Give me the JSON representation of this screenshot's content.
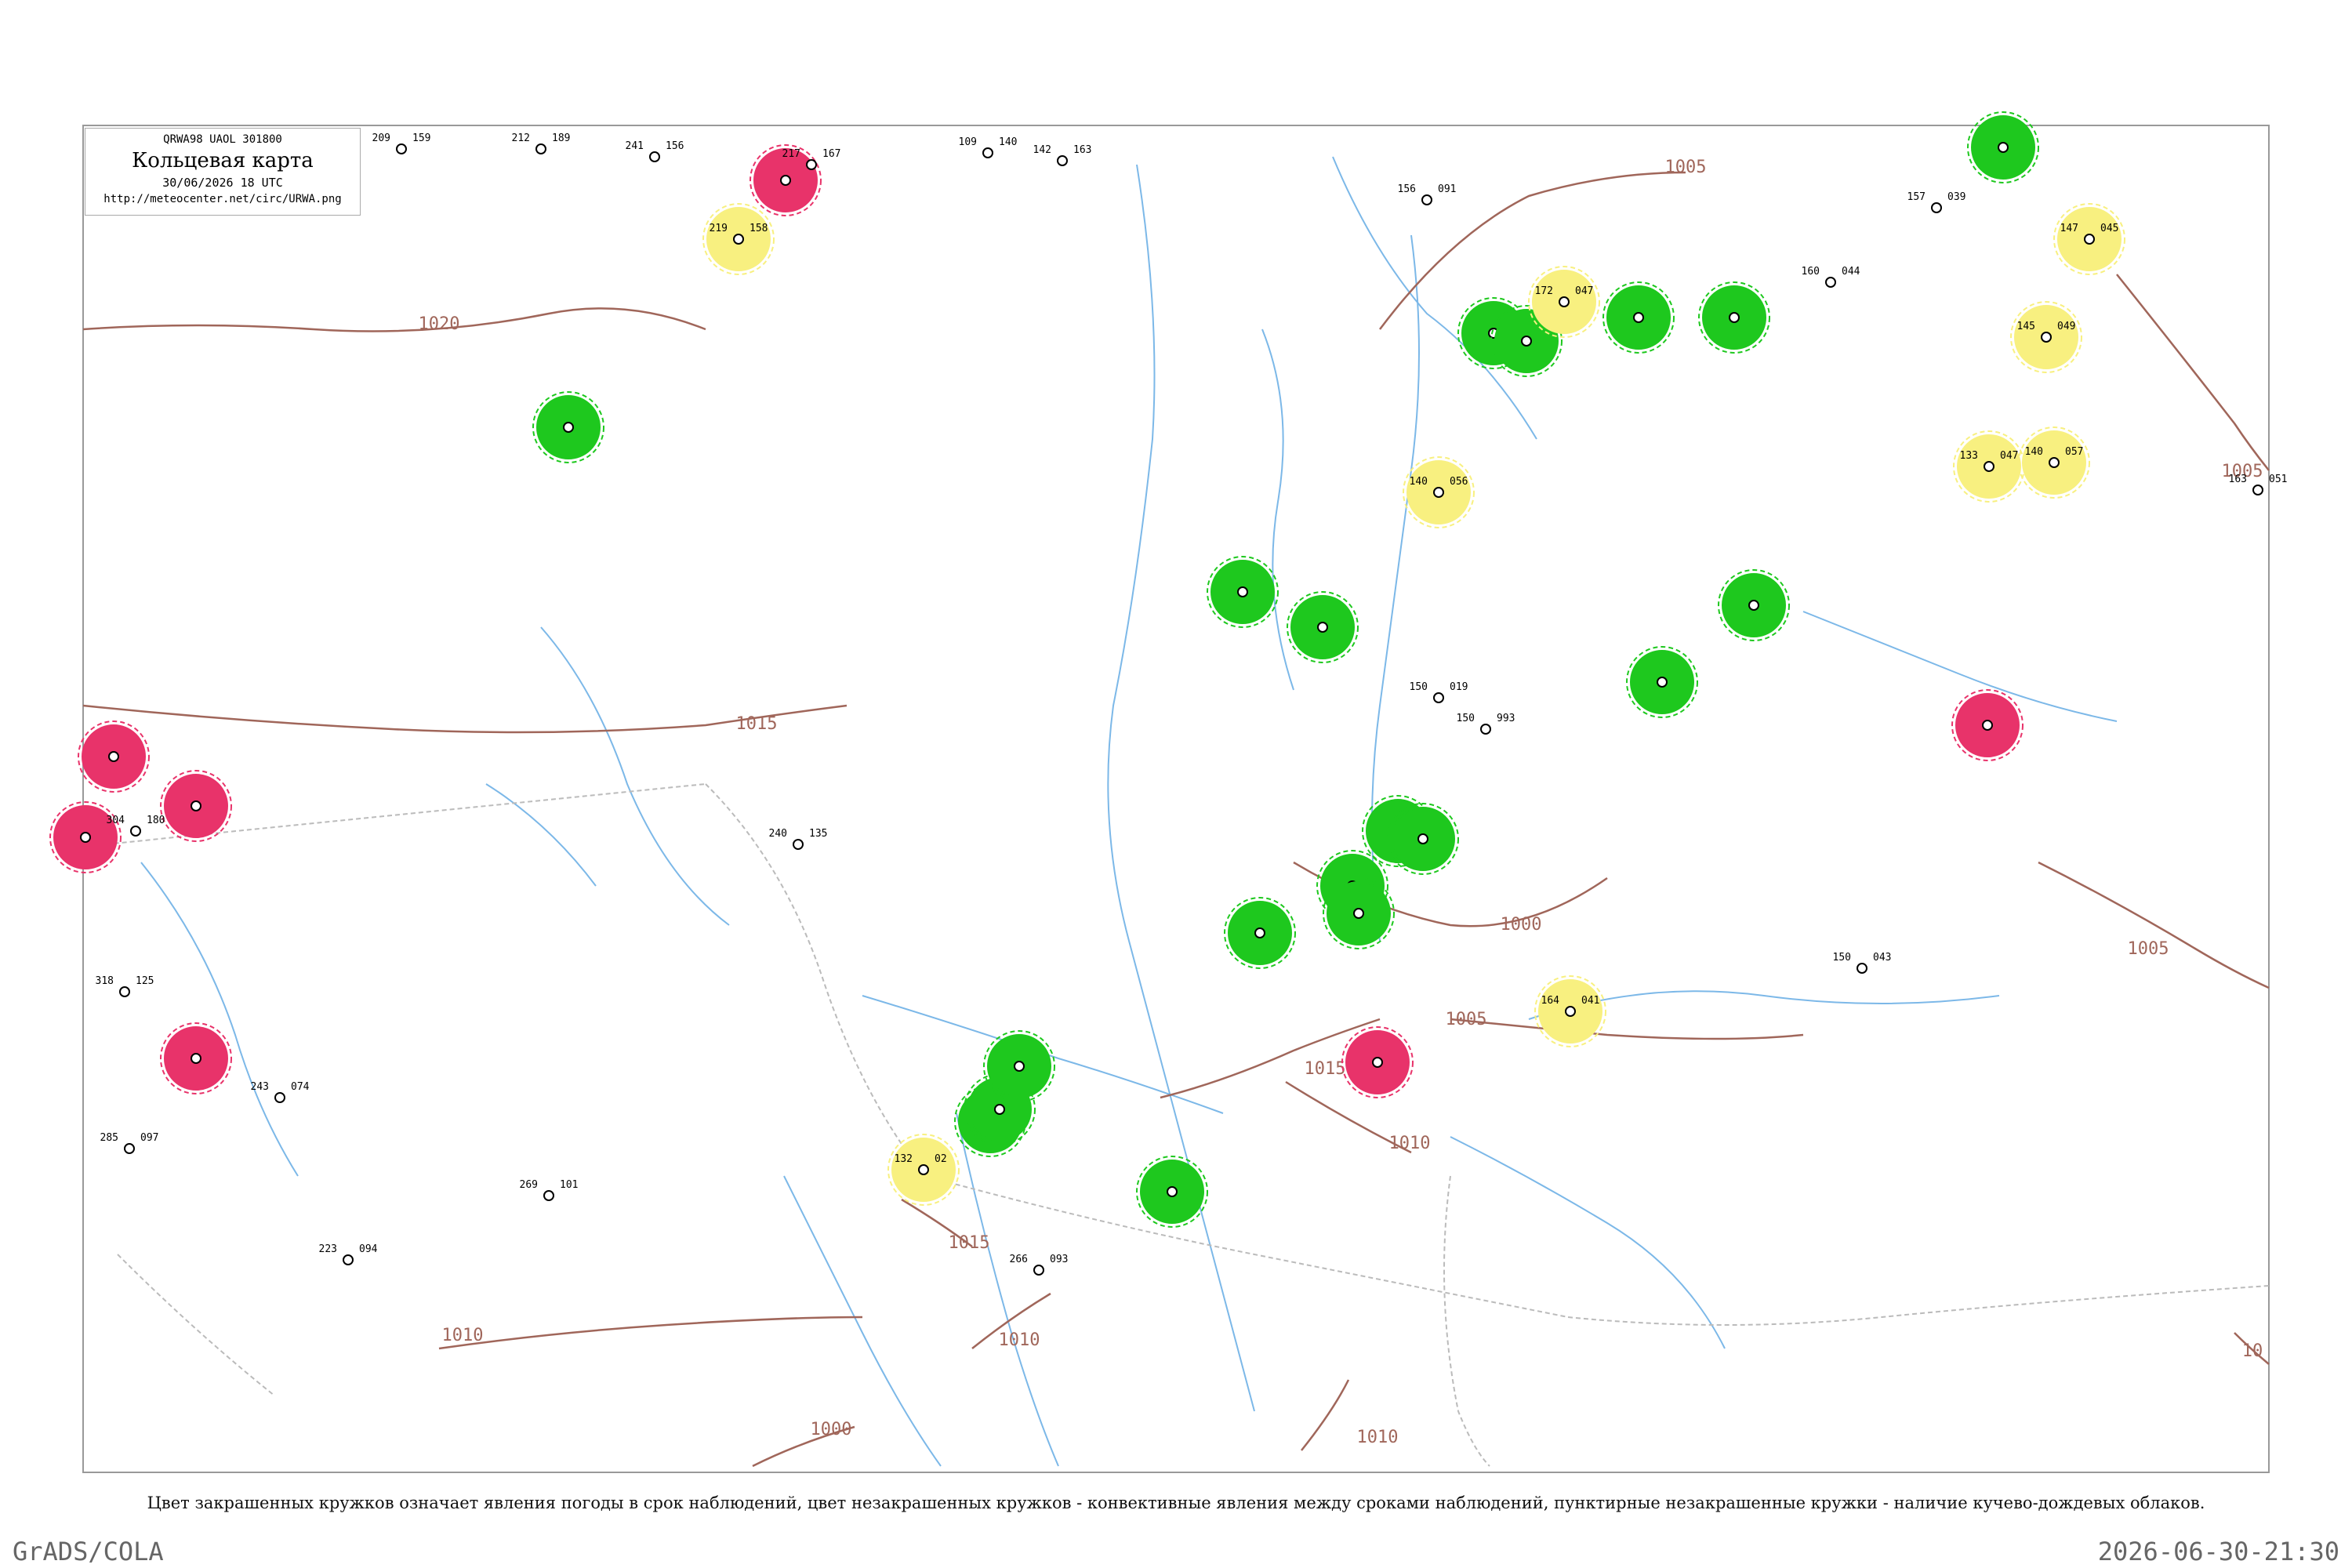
{
  "header": {
    "code_line": "QRWA98 UAOL 301800",
    "title": "Кольцевая карта",
    "datetime": "30/06/2026 18 UTC",
    "url": "http://meteocenter.net/circ/URWA.png"
  },
  "legend_text": "Цвет закрашенных кружков означает явления погоды в срок наблюдений, цвет незакрашенных кружков - конвективные явления между сроками наблюдений, пунктирные незакрашенные кружки - наличие кучево-дождевых облаков.",
  "footer": {
    "left": "GrADS/COLA",
    "right": "2026-06-30-21:30"
  },
  "colors": {
    "isobar": "#a0665a",
    "river": "#7cb8e8",
    "border": "#bbbbbb",
    "green": "#1ec81e",
    "red": "#e8336a",
    "yellow": "#f8f080"
  },
  "isobar_labels": [
    "1020",
    "1015",
    "1015",
    "1010",
    "1010",
    "1010",
    "1005",
    "1005",
    "1005",
    "1005",
    "1000",
    "1000",
    "1015",
    "1010",
    "10"
  ],
  "stations": [
    {
      "type": "green-filled",
      "p": "",
      "t": ""
    },
    {
      "type": "red-filled",
      "p": "",
      "t": ""
    },
    {
      "type": "yellow-filled",
      "p": "158",
      "t": "219"
    },
    {
      "type": "green-filled",
      "p": "",
      "t": ""
    },
    {
      "type": "green-filled",
      "p": "",
      "t": ""
    },
    {
      "type": "yellow-filled",
      "p": "047",
      "t": "172"
    },
    {
      "type": "green-filled",
      "p": "",
      "t": ""
    },
    {
      "type": "green-filled",
      "p": "",
      "t": ""
    },
    {
      "type": "yellow-filled",
      "p": "045",
      "t": "147"
    },
    {
      "type": "yellow-filled",
      "p": "049",
      "t": "145"
    },
    {
      "type": "yellow-filled",
      "p": "047",
      "t": "133"
    },
    {
      "type": "yellow-filled",
      "p": "057",
      "t": "140"
    },
    {
      "type": "yellow-filled",
      "p": "056",
      "t": "140"
    },
    {
      "type": "green-filled",
      "p": "",
      "t": ""
    },
    {
      "type": "green-filled",
      "p": "",
      "t": ""
    },
    {
      "type": "green-filled",
      "p": "",
      "t": ""
    },
    {
      "type": "green-filled",
      "p": "",
      "t": ""
    },
    {
      "type": "red-filled",
      "p": "",
      "t": ""
    },
    {
      "type": "green-filled",
      "p": "",
      "t": ""
    },
    {
      "type": "red-filled",
      "p": "",
      "t": ""
    },
    {
      "type": "red-filled",
      "p": "",
      "t": ""
    },
    {
      "type": "red-filled",
      "p": "",
      "t": ""
    },
    {
      "type": "green-filled",
      "p": "",
      "t": ""
    },
    {
      "type": "green-filled",
      "p": "",
      "t": ""
    },
    {
      "type": "green-filled",
      "p": "",
      "t": ""
    },
    {
      "type": "green-filled",
      "p": "",
      "t": ""
    },
    {
      "type": "green-filled",
      "p": "",
      "t": ""
    },
    {
      "type": "red-filled",
      "p": "",
      "t": ""
    },
    {
      "type": "yellow-filled",
      "p": "041",
      "t": "164"
    },
    {
      "type": "green-filled",
      "p": "",
      "t": ""
    },
    {
      "type": "red-filled",
      "p": "",
      "t": ""
    },
    {
      "type": "yellow-filled",
      "p": "02",
      "t": "132"
    },
    {
      "type": "green-filled",
      "p": "",
      "t": ""
    },
    {
      "type": "green-filled",
      "p": "",
      "t": ""
    },
    {
      "type": "green-filled",
      "p": "",
      "t": ""
    },
    {
      "type": "plain",
      "p": "159",
      "t": "209"
    },
    {
      "type": "plain",
      "p": "189",
      "t": "212"
    },
    {
      "type": "plain",
      "p": "156",
      "t": "241"
    },
    {
      "type": "plain",
      "p": "167",
      "t": "217"
    },
    {
      "type": "plain",
      "p": "140",
      "t": "109"
    },
    {
      "type": "plain",
      "p": "163",
      "t": "142"
    },
    {
      "type": "plain",
      "p": "091",
      "t": "156"
    },
    {
      "type": "plain",
      "p": "039",
      "t": "157"
    },
    {
      "type": "plain",
      "p": "044",
      "t": "160"
    },
    {
      "type": "plain",
      "p": "051",
      "t": "163"
    },
    {
      "type": "plain",
      "p": "019",
      "t": "150"
    },
    {
      "type": "plain",
      "p": "993",
      "t": "150"
    },
    {
      "type": "plain",
      "p": "043",
      "t": "150"
    },
    {
      "type": "plain",
      "p": "093",
      "t": "266"
    },
    {
      "type": "plain",
      "p": "097",
      "t": "285"
    },
    {
      "type": "plain",
      "p": "101",
      "t": "269"
    },
    {
      "type": "plain",
      "p": "135",
      "t": "240"
    },
    {
      "type": "plain",
      "p": "125",
      "t": "318"
    },
    {
      "type": "plain",
      "p": "180",
      "t": "304"
    },
    {
      "type": "plain",
      "p": "094",
      "t": "223"
    },
    {
      "type": "plain",
      "p": "074",
      "t": "243"
    }
  ]
}
